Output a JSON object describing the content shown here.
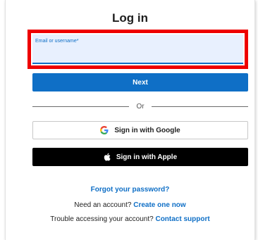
{
  "page": {
    "title": "Log in"
  },
  "email_field": {
    "label": "Email or username*",
    "value": ""
  },
  "buttons": {
    "next": "Next",
    "google": "Sign in with Google",
    "apple": "Sign in with Apple"
  },
  "divider": {
    "text": "Or"
  },
  "links": {
    "forgot_password": "Forgot your password?",
    "need_account_text": "Need an account?",
    "create_account": "Create one now",
    "trouble_text": "Trouble accessing your account?",
    "contact_support": "Contact support"
  },
  "icons": {
    "google": "google-logo-icon",
    "apple": "apple-logo-icon"
  },
  "colors": {
    "accent": "#0f6fc6",
    "highlight": "#ee0000",
    "field_bg": "#e8f0fe"
  }
}
